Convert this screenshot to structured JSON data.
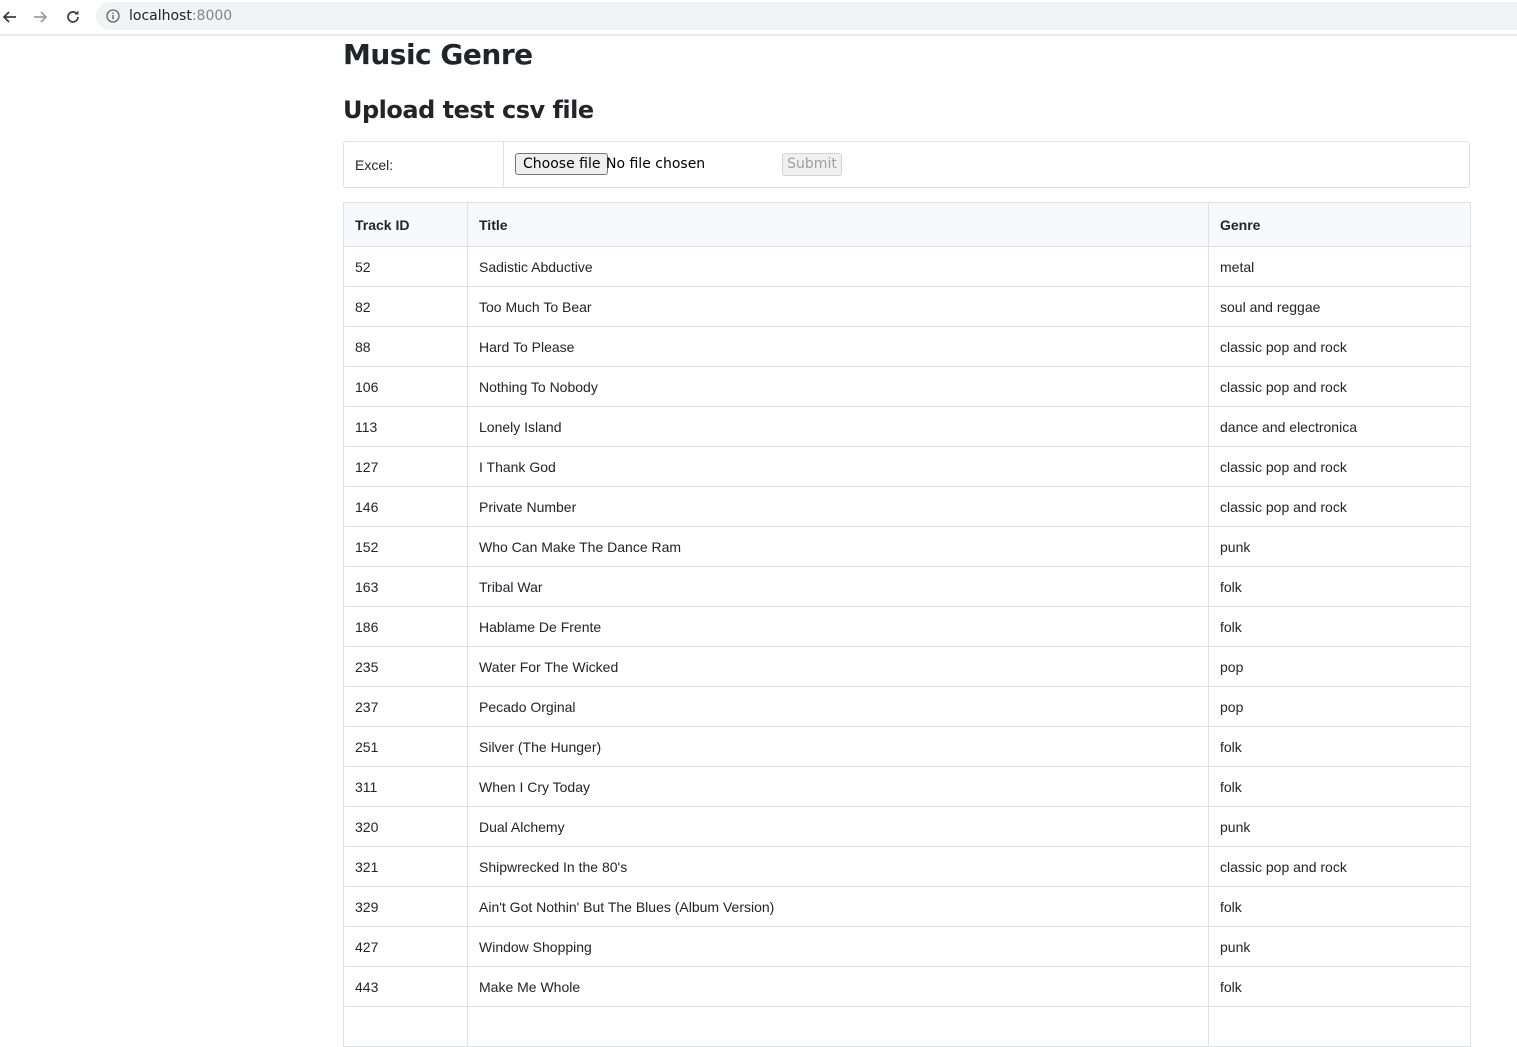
{
  "browser": {
    "url_host": "localhost",
    "url_port": ":8000"
  },
  "page": {
    "title": "Music Genre",
    "section_title": "Upload test csv file"
  },
  "upload": {
    "label": "Excel:",
    "choose_label": "Choose file",
    "file_status": "No file chosen",
    "submit_label": "Submit"
  },
  "table": {
    "headers": [
      "Track ID",
      "Title",
      "Genre"
    ],
    "rows": [
      [
        "52",
        "Sadistic Abductive",
        "metal"
      ],
      [
        "82",
        "Too Much To Bear",
        "soul and reggae"
      ],
      [
        "88",
        "Hard To Please",
        "classic pop and rock"
      ],
      [
        "106",
        "Nothing To Nobody",
        "classic pop and rock"
      ],
      [
        "113",
        "Lonely Island",
        "dance and electronica"
      ],
      [
        "127",
        "I Thank God",
        "classic pop and rock"
      ],
      [
        "146",
        "Private Number",
        "classic pop and rock"
      ],
      [
        "152",
        "Who Can Make The Dance Ram",
        "punk"
      ],
      [
        "163",
        "Tribal War",
        "folk"
      ],
      [
        "186",
        "Hablame De Frente",
        "folk"
      ],
      [
        "235",
        "Water For The Wicked",
        "pop"
      ],
      [
        "237",
        "Pecado Orginal",
        "pop"
      ],
      [
        "251",
        "Silver (The Hunger)",
        "folk"
      ],
      [
        "311",
        "When I Cry Today",
        "folk"
      ],
      [
        "320",
        "Dual Alchemy",
        "punk"
      ],
      [
        "321",
        "Shipwrecked In the 80's",
        "classic pop and rock"
      ],
      [
        "329",
        "Ain't Got Nothin' But The Blues (Album Version)",
        "folk"
      ],
      [
        "427",
        "Window Shopping",
        "punk"
      ],
      [
        "443",
        "Make Me Whole",
        "folk"
      ],
      [
        "",
        "",
        ""
      ]
    ]
  }
}
